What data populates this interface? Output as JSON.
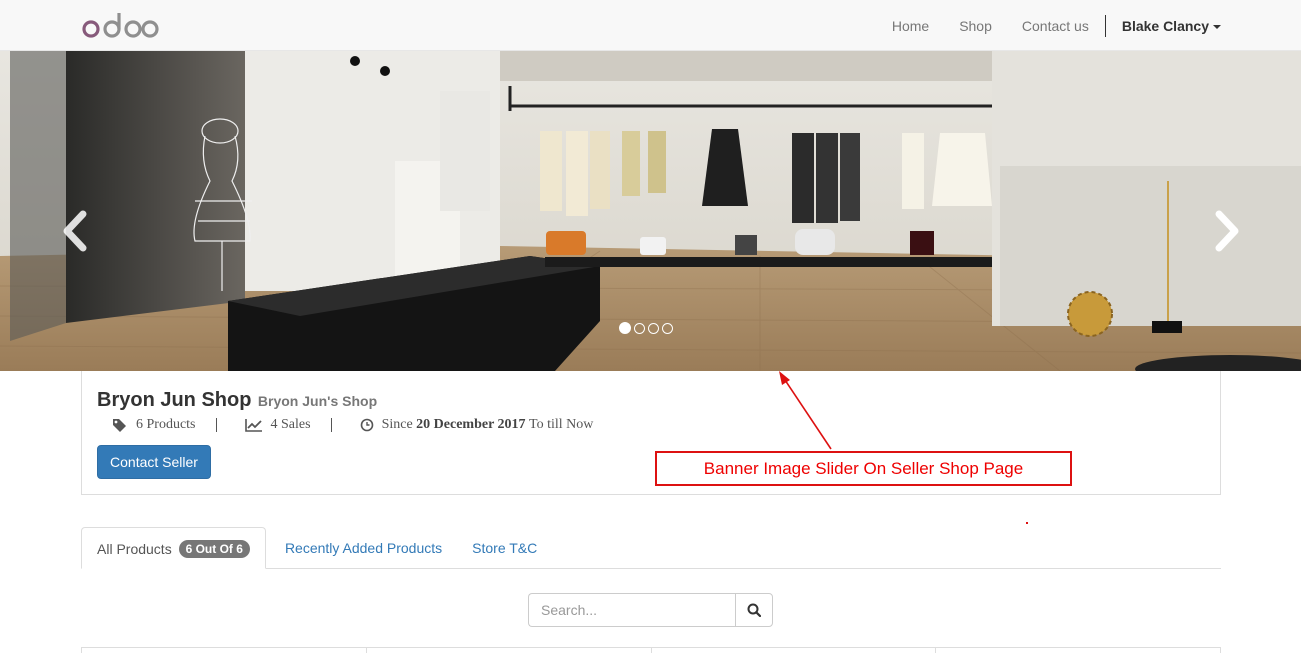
{
  "navbar": {
    "logo_text": "odoo",
    "items": [
      {
        "label": "Home"
      },
      {
        "label": "Shop"
      },
      {
        "label": "Contact us"
      }
    ],
    "user_name": "Blake Clancy"
  },
  "banner": {
    "icons": {
      "prev": "chevron-left-icon",
      "next": "chevron-right-icon"
    },
    "slide_count": 4,
    "active_slide": 1
  },
  "seller": {
    "shop_name": "Bryon Jun Shop",
    "shop_subtitle": "Bryon Jun's Shop",
    "products_text": "6 Products",
    "sales_text": "4 Sales",
    "since_prefix": "Since",
    "since_date": "20 December 2017",
    "since_suffix": "To till Now",
    "contact_button": "Contact Seller",
    "icons": {
      "products": "tags-icon",
      "sales": "line-chart-icon",
      "since": "clock-icon"
    }
  },
  "annotation": {
    "text": "Banner Image Slider On Seller Shop Page",
    "color": "#dd1111"
  },
  "tabs": [
    {
      "label": "All Products",
      "badge": "6 Out Of 6",
      "active": true
    },
    {
      "label": "Recently Added Products"
    },
    {
      "label": "Store T&C"
    }
  ],
  "search": {
    "placeholder": "Search...",
    "value": "",
    "icon": "search-icon"
  },
  "colors": {
    "primary": "#337ab7",
    "logo_purple": "#875a7b",
    "logo_gray": "#8f8f8f",
    "annotation_red": "#dd1111"
  }
}
